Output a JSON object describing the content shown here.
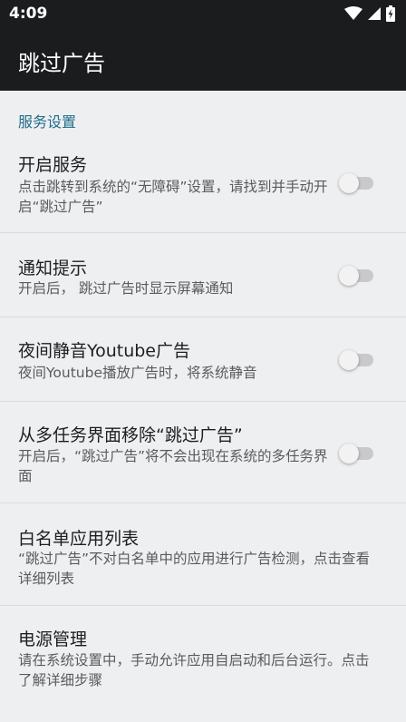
{
  "status_bar": {
    "time": "4:09"
  },
  "app_bar": {
    "title": "跳过广告"
  },
  "section": {
    "title": "服务设置"
  },
  "prefs": [
    {
      "title": "开启服务",
      "summary": "点击跳转到系统的“无障碍”设置，请找到并手动开启“跳过广告”",
      "toggle": false
    },
    {
      "title": "通知提示",
      "summary": "开启后， 跳过广告时显示屏幕通知",
      "toggle": false
    },
    {
      "title": "夜间静音Youtube广告",
      "summary": "夜间Youtube播放广告时，将系统静音",
      "toggle": false
    },
    {
      "title": "从多任务界面移除“跳过广告”",
      "summary": "开启后，“跳过广告”将不会出现在系统的多任务界面",
      "toggle": false
    },
    {
      "title": "白名单应用列表",
      "summary": "“跳过广告”不对白名单中的应用进行广告检测，点击查看详细列表"
    },
    {
      "title": "电源管理",
      "summary": "请在系统设置中，手动允许应用自启动和后台运行。点击了解详细步骤"
    }
  ],
  "colors": {
    "bar": "#1b1c1d",
    "background": "#eeeff1",
    "accent": "#1f6d8a"
  }
}
